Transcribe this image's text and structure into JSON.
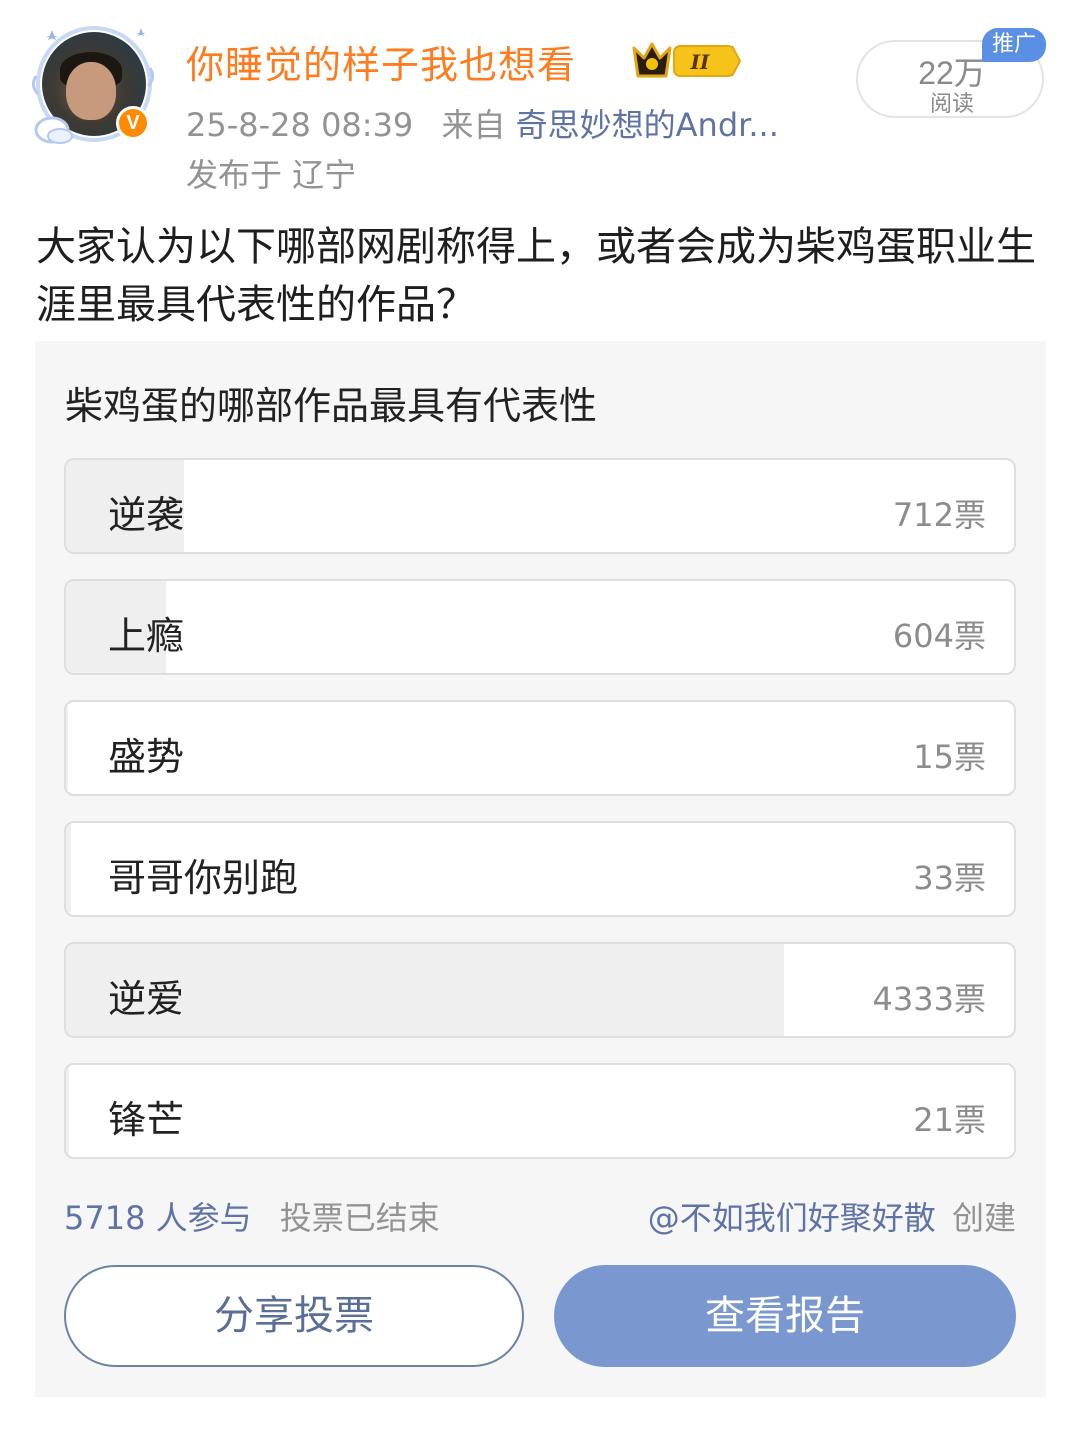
{
  "post": {
    "author": "你睡觉的样子我也想看",
    "level_badge": "II",
    "verified_badge": "V",
    "timestamp": "25-8-28 08:39",
    "source_prefix": "来自",
    "source_name": "奇思妙想的Andr...",
    "location": "发布于 辽宁",
    "reads_count": "22万",
    "reads_label": "阅读",
    "promo_tag": "推广",
    "text": "大家认为以下哪部网剧称得上，或者会成为柴鸡蛋职业生涯里最具代表性的作品？"
  },
  "poll": {
    "title": "柴鸡蛋的哪部作品最具有代表性",
    "total_votes": 5718,
    "options": [
      {
        "label": "逆袭",
        "votes_text": "712票",
        "votes": 712
      },
      {
        "label": "上瘾",
        "votes_text": "604票",
        "votes": 604
      },
      {
        "label": "盛势",
        "votes_text": "15票",
        "votes": 15
      },
      {
        "label": "哥哥你别跑",
        "votes_text": "33票",
        "votes": 33
      },
      {
        "label": "逆爱",
        "votes_text": "4333票",
        "votes": 4333
      },
      {
        "label": "锋芒",
        "votes_text": "21票",
        "votes": 21
      }
    ],
    "participants": "5718 人参与",
    "status": "投票已结束",
    "creator": "@不如我们好聚好散",
    "created_suffix": "创建",
    "share_button": "分享投票",
    "report_button": "查看报告"
  },
  "colors": {
    "username": "#ff7b20",
    "link": "#5f73a6",
    "report_button": "#7a98cf",
    "promo_tag": "#5a8fe6"
  }
}
